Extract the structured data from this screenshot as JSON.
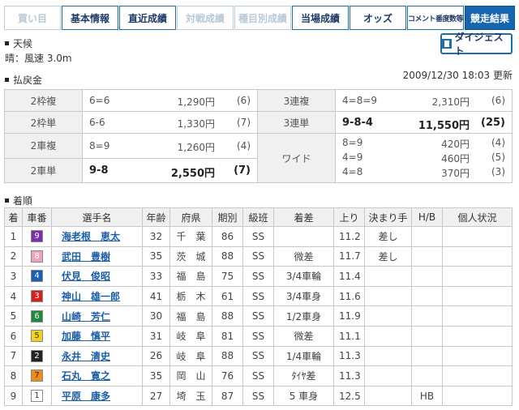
{
  "tabs": [
    {
      "label": "買い目",
      "state": "disabled"
    },
    {
      "label": "基本情報",
      "state": "normal"
    },
    {
      "label": "直近成績",
      "state": "normal"
    },
    {
      "label": "対戦成績",
      "state": "disabled"
    },
    {
      "label": "種目別成績",
      "state": "disabled"
    },
    {
      "label": "当場成績",
      "state": "normal"
    },
    {
      "label": "オッズ",
      "state": "normal"
    },
    {
      "label": "コメント番度数等",
      "state": "normal"
    },
    {
      "label": "競走結果",
      "state": "active"
    }
  ],
  "weather": {
    "heading": "天候",
    "text": "晴：風速 3.0m"
  },
  "digest_label": "ダイジェスト",
  "payout": {
    "heading": "払戻金",
    "updated": "2009/12/30 18:03 更新",
    "left": [
      {
        "label": "2枠複",
        "combo": "6=6",
        "amount": "1,290円",
        "pop": "(6)",
        "bold": false
      },
      {
        "label": "2枠単",
        "combo": "6-6",
        "amount": "1,330円",
        "pop": "(7)",
        "bold": false
      },
      {
        "label": "2車複",
        "combo": "8=9",
        "amount": "1,260円",
        "pop": "(4)",
        "bold": false
      },
      {
        "label": "2車単",
        "combo": "9-8",
        "amount": "2,550円",
        "pop": "(7)",
        "bold": true
      }
    ],
    "right": [
      {
        "label": "3連複",
        "combo": "4=8=9",
        "amount": "2,310円",
        "pop": "(6)",
        "bold": false
      },
      {
        "label": "3連単",
        "combo": "9-8-4",
        "amount": "11,550円",
        "pop": "(25)",
        "bold": true
      }
    ],
    "wide": {
      "label": "ワイド",
      "rows": [
        {
          "combo": "8=9",
          "amount": "420円",
          "pop": "(4)"
        },
        {
          "combo": "4=9",
          "amount": "460円",
          "pop": "(5)"
        },
        {
          "combo": "4=8",
          "amount": "370円",
          "pop": "(3)"
        }
      ]
    }
  },
  "results": {
    "heading": "着順",
    "headers": [
      "着",
      "車番",
      "選手名",
      "年齢",
      "府県",
      "期別",
      "級班",
      "着差",
      "上り",
      "決まり手",
      "H/B",
      "個人状況"
    ],
    "rows": [
      {
        "rank": "1",
        "car": "9",
        "bg": "#7b2fa8",
        "fg": "#ffffff",
        "name": "海老根　恵太",
        "age": "32",
        "pref": "千　葉",
        "term": "86",
        "cls": "SS",
        "margin": "",
        "time": "11.2",
        "kimarite": "差し",
        "hb": "",
        "status": ""
      },
      {
        "rank": "2",
        "car": "8",
        "bg": "#f0a0c0",
        "fg": "#ffffff",
        "name": "武田　豊樹",
        "age": "35",
        "pref": "茨　城",
        "term": "88",
        "cls": "SS",
        "margin": "微差",
        "time": "11.7",
        "kimarite": "差し",
        "hb": "",
        "status": ""
      },
      {
        "rank": "3",
        "car": "4",
        "bg": "#1a5fb4",
        "fg": "#ffffff",
        "name": "伏見　俊昭",
        "age": "33",
        "pref": "福　島",
        "term": "75",
        "cls": "SS",
        "margin": "3/4車輪",
        "time": "11.4",
        "kimarite": "",
        "hb": "",
        "status": ""
      },
      {
        "rank": "4",
        "car": "3",
        "bg": "#d42020",
        "fg": "#ffffff",
        "name": "神山　雄一郎",
        "age": "41",
        "pref": "栃　木",
        "term": "61",
        "cls": "SS",
        "margin": "3/4車身",
        "time": "11.6",
        "kimarite": "",
        "hb": "",
        "status": ""
      },
      {
        "rank": "5",
        "car": "6",
        "bg": "#1e8a3c",
        "fg": "#ffffff",
        "name": "山崎　芳仁",
        "age": "30",
        "pref": "福　島",
        "term": "88",
        "cls": "SS",
        "margin": "1/2車身",
        "time": "11.9",
        "kimarite": "",
        "hb": "",
        "status": ""
      },
      {
        "rank": "6",
        "car": "5",
        "bg": "#f2d21a",
        "fg": "#333333",
        "name": "加藤　慎平",
        "age": "31",
        "pref": "岐　阜",
        "term": "81",
        "cls": "SS",
        "margin": "微差",
        "time": "11.1",
        "kimarite": "",
        "hb": "",
        "status": ""
      },
      {
        "rank": "7",
        "car": "2",
        "bg": "#222222",
        "fg": "#ffffff",
        "name": "永井　清史",
        "age": "26",
        "pref": "岐　阜",
        "term": "88",
        "cls": "SS",
        "margin": "1/4車輪",
        "time": "11.3",
        "kimarite": "",
        "hb": "",
        "status": ""
      },
      {
        "rank": "8",
        "car": "7",
        "bg": "#f08a1a",
        "fg": "#333333",
        "name": "石丸　寛之",
        "age": "35",
        "pref": "岡　山",
        "term": "76",
        "cls": "SS",
        "margin": "ﾀｲﾔ差",
        "time": "11.3",
        "kimarite": "",
        "hb": "",
        "status": ""
      },
      {
        "rank": "9",
        "car": "1",
        "bg": "#ffffff",
        "fg": "#333333",
        "name": "平原　康多",
        "age": "27",
        "pref": "埼　玉",
        "term": "87",
        "cls": "SS",
        "margin": "5 車身",
        "time": "12.5",
        "kimarite": "",
        "hb": "HB",
        "status": ""
      }
    ]
  }
}
